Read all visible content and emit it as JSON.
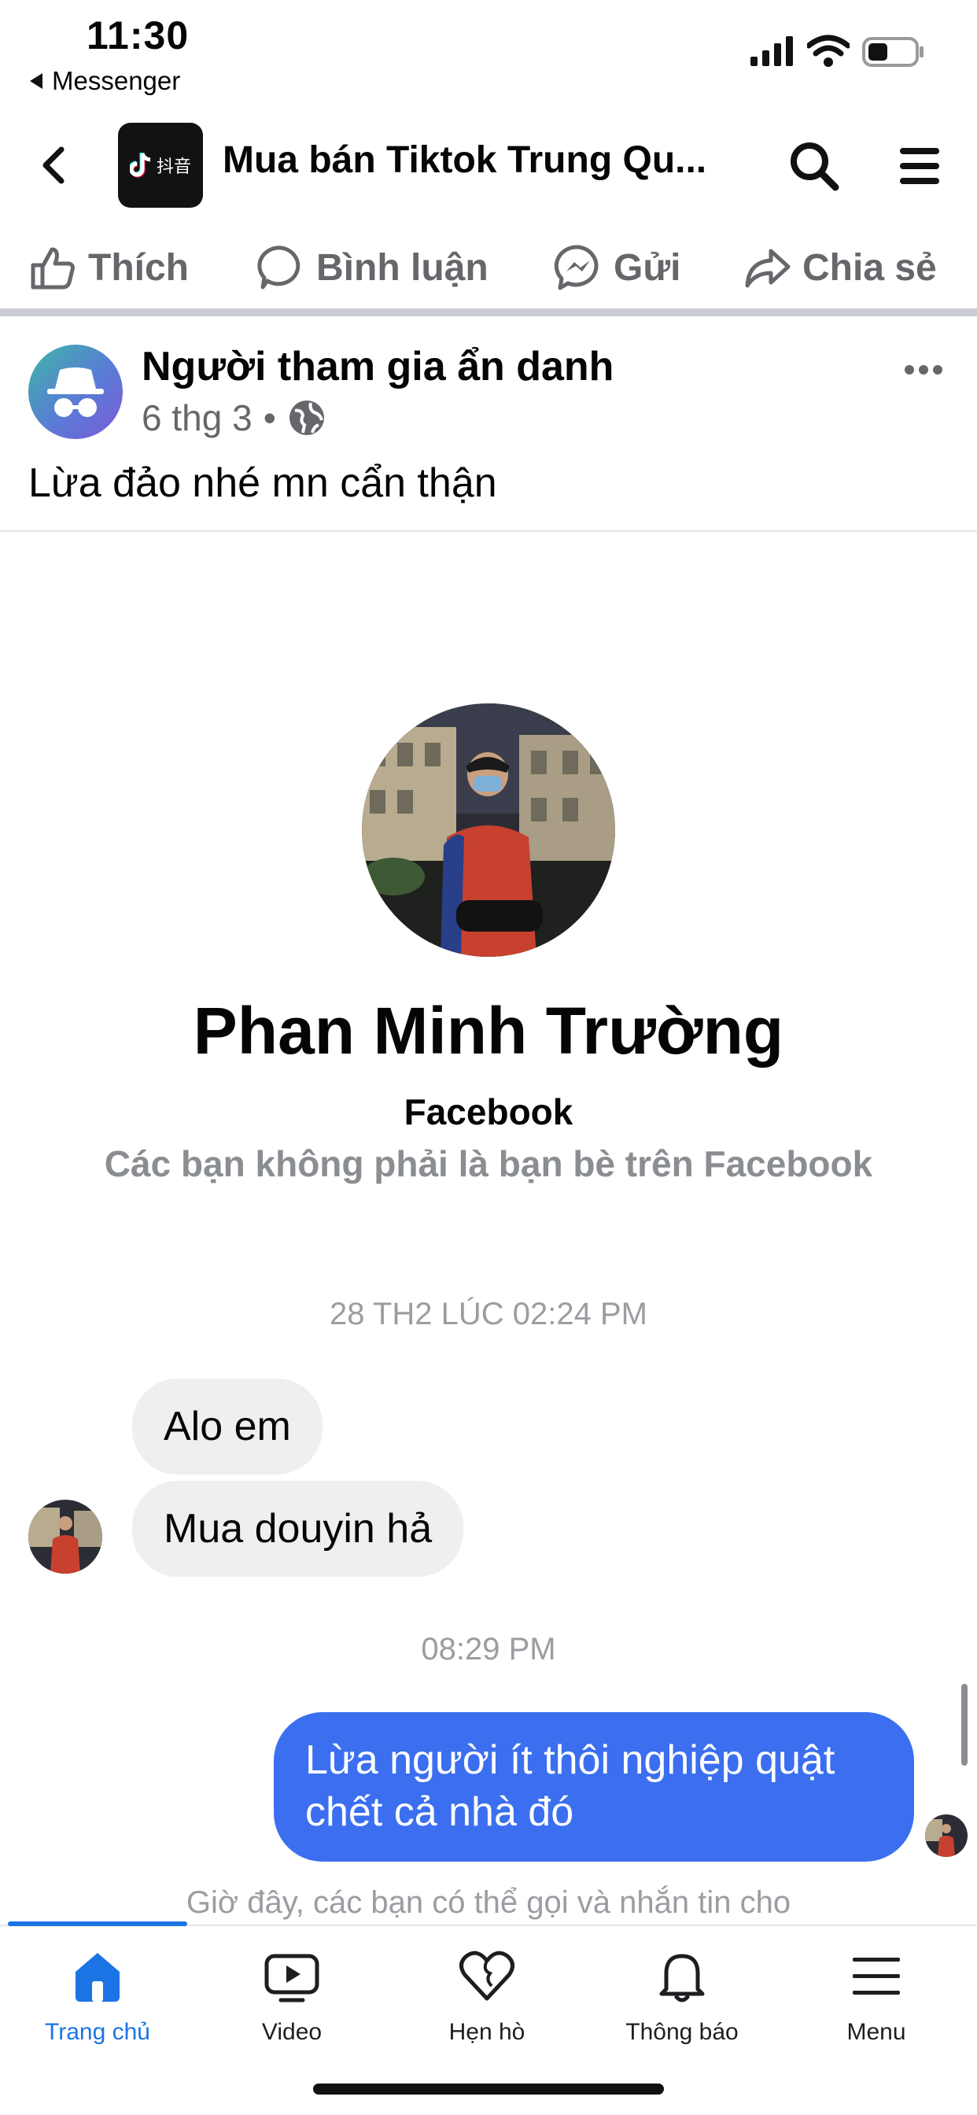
{
  "status_bar": {
    "time": "11:30",
    "back_label": "Messenger",
    "icons": [
      "cellular-signal-icon",
      "wifi-icon",
      "battery-icon"
    ]
  },
  "header": {
    "title": "Mua bán Tiktok Trung Qu...",
    "group_logo_text": "抖音",
    "icons": [
      "back-chevron-icon",
      "search-icon",
      "hamburger-menu-icon"
    ]
  },
  "actions": {
    "like": "Thích",
    "comment": "Bình luận",
    "send": "Gửi",
    "share": "Chia sẻ"
  },
  "post": {
    "author": "Người tham gia ẩn danh",
    "date": "6 thg 3",
    "separator": "•",
    "privacy_icon": "globe-icon",
    "text": "Lừa đảo nhé mn cẩn thận"
  },
  "chat": {
    "profile_name": "Phan Minh Trường",
    "profile_sub": "Facebook",
    "profile_note": "Các bạn không phải là bạn bè trên Facebook",
    "timestamp_1": "28 TH2 LÚC 02:24 PM",
    "incoming": [
      "Alo em",
      "Mua douyin hả"
    ],
    "timestamp_2": "08:29 PM",
    "outgoing_line1": "Lừa người ít thôi nghiệp quật",
    "outgoing_line2": "chết cả nhà đó",
    "bottom_note": "Giờ đây, các bạn có thể gọi và nhắn tin cho"
  },
  "tabbar": {
    "tabs": [
      {
        "label": "Trang chủ",
        "icon": "home-icon",
        "active": true
      },
      {
        "label": "Video",
        "icon": "video-icon",
        "active": false
      },
      {
        "label": "Hẹn hò",
        "icon": "dating-heart-icon",
        "active": false
      },
      {
        "label": "Thông báo",
        "icon": "bell-icon",
        "active": false
      },
      {
        "label": "Menu",
        "icon": "menu-icon",
        "active": false
      }
    ]
  },
  "colors": {
    "accent": "#1b74e4",
    "outgoing_bubble": "#3b6ff0",
    "incoming_bubble": "#efefef",
    "secondary_text": "#65676b"
  }
}
